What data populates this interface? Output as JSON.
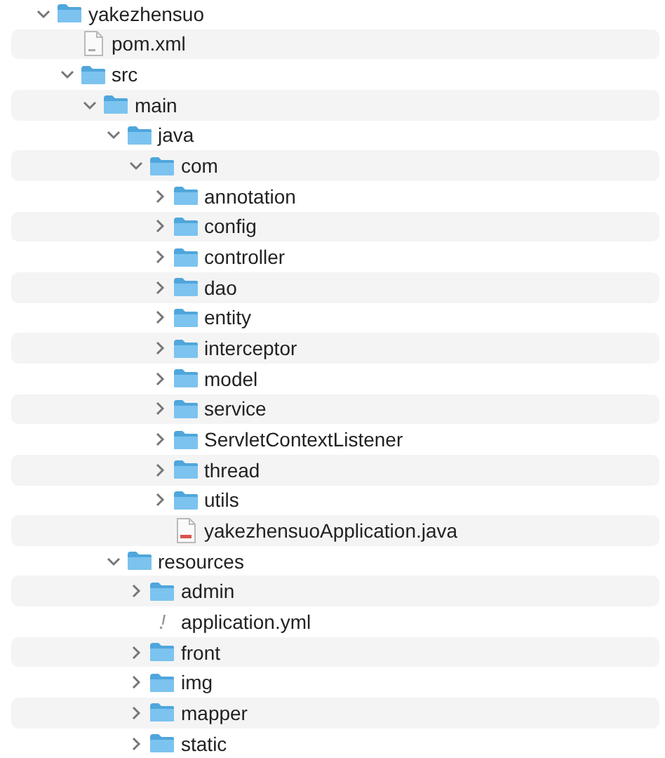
{
  "tree": [
    {
      "name": "yakezhensuo",
      "kind": "folder",
      "expanded": true,
      "children": [
        {
          "name": "pom.xml",
          "kind": "document"
        },
        {
          "name": "src",
          "kind": "folder",
          "expanded": true,
          "children": [
            {
              "name": "main",
              "kind": "folder",
              "expanded": true,
              "children": [
                {
                  "name": "java",
                  "kind": "folder",
                  "expanded": true,
                  "children": [
                    {
                      "name": "com",
                      "kind": "folder",
                      "expanded": true,
                      "children": [
                        {
                          "name": "annotation",
                          "kind": "folder",
                          "expanded": false
                        },
                        {
                          "name": "config",
                          "kind": "folder",
                          "expanded": false
                        },
                        {
                          "name": "controller",
                          "kind": "folder",
                          "expanded": false
                        },
                        {
                          "name": "dao",
                          "kind": "folder",
                          "expanded": false
                        },
                        {
                          "name": "entity",
                          "kind": "folder",
                          "expanded": false
                        },
                        {
                          "name": "interceptor",
                          "kind": "folder",
                          "expanded": false
                        },
                        {
                          "name": "model",
                          "kind": "folder",
                          "expanded": false
                        },
                        {
                          "name": "service",
                          "kind": "folder",
                          "expanded": false
                        },
                        {
                          "name": "ServletContextListener",
                          "kind": "folder",
                          "expanded": false
                        },
                        {
                          "name": "thread",
                          "kind": "folder",
                          "expanded": false
                        },
                        {
                          "name": "utils",
                          "kind": "folder",
                          "expanded": false
                        },
                        {
                          "name": "yakezhensuoApplication.java",
                          "kind": "java"
                        }
                      ]
                    }
                  ]
                },
                {
                  "name": "resources",
                  "kind": "folder",
                  "expanded": true,
                  "children": [
                    {
                      "name": "admin",
                      "kind": "folder",
                      "expanded": false
                    },
                    {
                      "name": "application.yml",
                      "kind": "config"
                    },
                    {
                      "name": "front",
                      "kind": "folder",
                      "expanded": false
                    },
                    {
                      "name": "img",
                      "kind": "folder",
                      "expanded": false
                    },
                    {
                      "name": "mapper",
                      "kind": "folder",
                      "expanded": false
                    },
                    {
                      "name": "static",
                      "kind": "folder",
                      "expanded": false
                    }
                  ]
                }
              ]
            }
          ]
        }
      ]
    }
  ]
}
